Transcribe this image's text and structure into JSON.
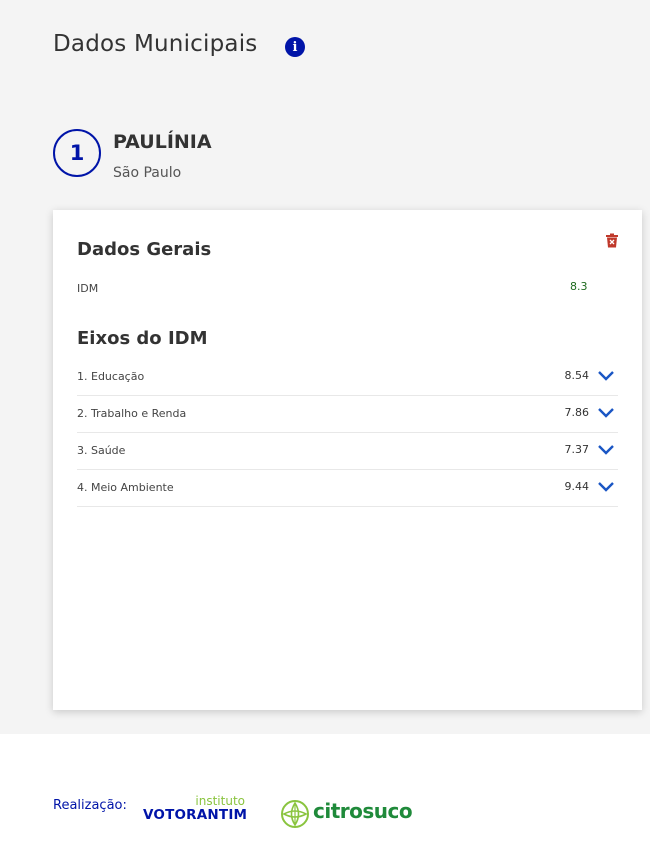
{
  "header": {
    "title": "Dados Municipais",
    "info_icon": "info-icon"
  },
  "municipality": {
    "rank": "1",
    "name": "PAULÍNIA",
    "state": "São Paulo"
  },
  "card": {
    "general_title": "Dados Gerais",
    "idm_label": "IDM",
    "idm_value": "8.3",
    "axes_title": "Eixos do IDM",
    "axes": [
      {
        "label": "1. Educação",
        "value": "8.54"
      },
      {
        "label": "2. Trabalho e Renda",
        "value": "7.86"
      },
      {
        "label": "3. Saúde",
        "value": "7.37"
      },
      {
        "label": "4. Meio Ambiente",
        "value": "9.44"
      }
    ]
  },
  "footer": {
    "realizacao_label": "Realização:",
    "votorantim_top": "instituto",
    "votorantim_bottom": "VOTORANTIM",
    "citrosuco": "citrosuco"
  },
  "colors": {
    "brand_blue": "#0014a8",
    "delete_red": "#c0392b",
    "idm_green": "#1e6a1e",
    "chevron_blue": "#1a56c4",
    "citrosuco_green": "#1f8a3a",
    "votorantim_green": "#8ac43f"
  }
}
